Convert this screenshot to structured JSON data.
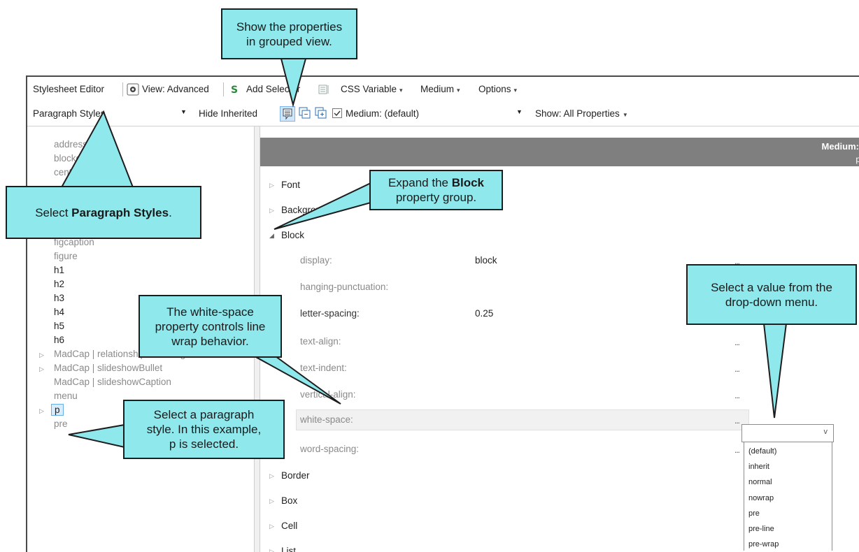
{
  "toolbar1": {
    "editor_label": "Stylesheet Editor",
    "view_label": "View: Advanced",
    "add_selector_label": "Add Selector",
    "css_variable_label": "CSS Variable",
    "medium_label": "Medium",
    "options_label": "Options"
  },
  "toolbar2": {
    "style_select_value": "Paragraph Styles",
    "hide_inherited_label": "Hide Inherited",
    "medium_select_value": "Medium: (default)",
    "show_label": "Show: All Properties"
  },
  "header": {
    "medium_text": "Medium:",
    "sub_text": "p"
  },
  "left_tree": [
    {
      "label": "address"
    },
    {
      "label": "blockquote"
    },
    {
      "label": "center"
    },
    {
      "label": "figcaption"
    },
    {
      "label": "figure"
    },
    {
      "label": "h1"
    },
    {
      "label": "h2"
    },
    {
      "label": "h3"
    },
    {
      "label": "h4"
    },
    {
      "label": "h5"
    },
    {
      "label": "h6"
    },
    {
      "label": "MadCap | relationshipsHeading"
    },
    {
      "label": "MadCap | slideshowBullet"
    },
    {
      "label": "MadCap | slideshowCaption"
    },
    {
      "label": "menu"
    },
    {
      "label": "p"
    },
    {
      "label": "pre"
    }
  ],
  "groups": {
    "font": "Font",
    "background": "Background",
    "block": "Block",
    "border": "Border",
    "box": "Box",
    "cell": "Cell",
    "list": "List"
  },
  "properties": [
    {
      "name": "display:",
      "value": "block",
      "more": "..."
    },
    {
      "name": "hanging-punctuation:",
      "value": "",
      "more": ""
    },
    {
      "name": "letter-spacing:",
      "value": "0.25",
      "more": ""
    },
    {
      "name": "text-align:",
      "value": "",
      "more": "..."
    },
    {
      "name": "text-indent:",
      "value": "",
      "more": "..."
    },
    {
      "name": "vertical-align:",
      "value": "",
      "more": "..."
    },
    {
      "name": "white-space:",
      "value": "",
      "more": "..."
    },
    {
      "name": "word-spacing:",
      "value": "",
      "more": "..."
    }
  ],
  "dropdown": {
    "caret": "v",
    "options": [
      "(default)",
      "inherit",
      "normal",
      "nowrap",
      "pre",
      "pre-line",
      "pre-wrap"
    ]
  },
  "callouts": {
    "grouped_line1": "Show the properties",
    "grouped_line2": "in grouped view.",
    "select_pre": "Select ",
    "select_bold": "Paragraph Styles",
    "select_post": ".",
    "expand_pre": "Expand the ",
    "expand_bold": "Block",
    "expand_line2": "property group.",
    "ws_line1": "The white-space",
    "ws_line2": "property controls line",
    "ws_line3": "wrap behavior.",
    "para_line1": "Select a paragraph",
    "para_line2": "style. In this example,",
    "para_line3": "p is selected.",
    "value_line1": "Select a value from the",
    "value_line2": "drop-down menu."
  },
  "colors": {
    "callout_fill": "#8ee8ec",
    "header_gray": "#7f7f7f"
  }
}
